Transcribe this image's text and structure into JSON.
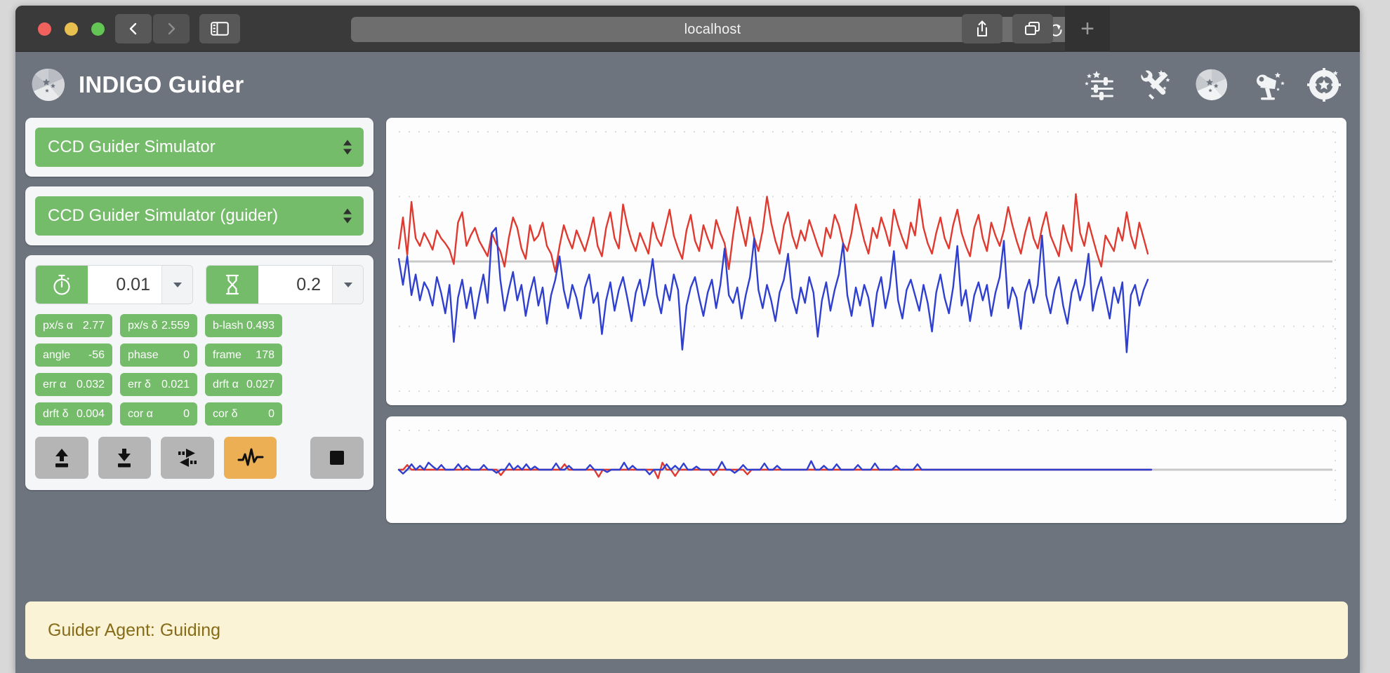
{
  "browser": {
    "url_text": "localhost",
    "back_icon": "chevron-left-icon",
    "forward_icon": "chevron-right-icon",
    "sidebar_icon": "sidebar-toggle-icon",
    "reload_icon": "reload-icon",
    "share_icon": "share-icon",
    "tabs_icon": "tab-overview-icon",
    "newtab_label": "+"
  },
  "app": {
    "title": "INDIGO Guider",
    "logo_icon": "aperture-star-logo-icon",
    "toolbar_icons": [
      {
        "name": "sliders-star-icon",
        "label": "Guider settings"
      },
      {
        "name": "tools-star-icon",
        "label": "Tools"
      },
      {
        "name": "aperture-star-icon",
        "label": "Imager"
      },
      {
        "name": "telescope-star-icon",
        "label": "Mount"
      },
      {
        "name": "guider-target-star-icon",
        "label": "Guider"
      }
    ]
  },
  "selectors": [
    {
      "name": "device-select",
      "value": "CCD Guider Simulator"
    },
    {
      "name": "guider-select",
      "value": "CCD Guider Simulator (guider)"
    }
  ],
  "steppers": [
    {
      "name": "exposure-stepper",
      "icon": "stopwatch-icon",
      "value": "0.01"
    },
    {
      "name": "delay-stepper",
      "icon": "hourglass-icon",
      "value": "0.2"
    }
  ],
  "badges": [
    {
      "label": "px/s α",
      "value": "2.77"
    },
    {
      "label": "px/s δ",
      "value": "2.559"
    },
    {
      "label": "b-lash",
      "value": "0.493"
    },
    {
      "label": "angle",
      "value": "-56"
    },
    {
      "label": "phase",
      "value": "0"
    },
    {
      "label": "frame",
      "value": "178"
    },
    {
      "label": "err α",
      "value": "0.032"
    },
    {
      "label": "err δ",
      "value": "0.021"
    },
    {
      "label": "drft α",
      "value": "0.027"
    },
    {
      "label": "drft δ",
      "value": "0.004"
    },
    {
      "label": "cor α",
      "value": "0"
    },
    {
      "label": "cor δ",
      "value": "0"
    }
  ],
  "buttons": [
    {
      "name": "upload-button",
      "icon": "upload-icon",
      "active": false
    },
    {
      "name": "download-button",
      "icon": "download-icon",
      "active": false
    },
    {
      "name": "calibrate-button",
      "icon": "calibrate-arrows-icon",
      "active": false
    },
    {
      "name": "guide-button",
      "icon": "pulse-icon",
      "active": true
    },
    {
      "name": "stop-button",
      "icon": "stop-square-icon",
      "active": false
    }
  ],
  "status": {
    "text": "Guider Agent: Guiding"
  },
  "colors": {
    "accent_green": "#74bb6a",
    "active_orange": "#edaf54",
    "app_background": "#6d747e",
    "status_background": "#fbf3d5",
    "status_text": "#866c18",
    "trace_alpha": "#e03a30",
    "trace_delta": "#2f3fd0",
    "zero_line": "#c9c9c9"
  },
  "chart_data": [
    {
      "type": "line",
      "name": "guiding-error-chart",
      "title": "",
      "xlabel": "",
      "ylabel": "",
      "grid": true,
      "gridlines_y": [
        0.0,
        0.25,
        0.75,
        1.0
      ],
      "zero_line_y": 0.5,
      "ylim": [
        -1,
        1
      ],
      "series": [
        {
          "name": "err α",
          "color": "#e03a30",
          "values": [
            0.1,
            0.34,
            0.05,
            0.46,
            0.18,
            0.12,
            0.22,
            0.16,
            0.09,
            0.24,
            0.18,
            0.14,
            0.09,
            -0.02,
            0.3,
            0.38,
            0.12,
            0.2,
            0.26,
            0.16,
            0.1,
            0.04,
            0.22,
            0.14,
            0.08,
            -0.04,
            0.18,
            0.34,
            0.26,
            0.1,
            0.02,
            0.28,
            0.16,
            0.2,
            0.3,
            0.12,
            0.06,
            -0.08,
            0.12,
            0.28,
            0.18,
            0.1,
            0.24,
            0.16,
            0.08,
            0.2,
            0.34,
            0.12,
            0.04,
            0.26,
            0.38,
            0.18,
            0.1,
            0.44,
            0.28,
            0.16,
            0.08,
            0.22,
            0.14,
            0.06,
            0.3,
            0.18,
            0.12,
            0.26,
            0.4,
            0.2,
            0.1,
            0.02,
            0.24,
            0.36,
            0.16,
            0.08,
            0.28,
            0.18,
            0.1,
            0.32,
            0.22,
            0.14,
            -0.06,
            0.2,
            0.42,
            0.26,
            0.12,
            0.34,
            0.18,
            0.08,
            0.24,
            0.5,
            0.3,
            0.16,
            0.06,
            0.28,
            0.38,
            0.2,
            0.1,
            0.24,
            0.16,
            0.32,
            0.22,
            0.12,
            0.04,
            0.26,
            0.18,
            0.36,
            0.28,
            0.14,
            0.08,
            0.22,
            0.44,
            0.3,
            0.16,
            0.06,
            0.26,
            0.18,
            0.34,
            0.24,
            0.12,
            0.4,
            0.28,
            0.18,
            0.1,
            0.3,
            0.2,
            0.48,
            0.26,
            0.14,
            0.06,
            0.22,
            0.34,
            0.18,
            0.1,
            0.28,
            0.4,
            0.22,
            0.12,
            0.04,
            0.26,
            0.36,
            0.18,
            0.08,
            0.3,
            0.2,
            0.12,
            0.24,
            0.42,
            0.28,
            0.16,
            0.06,
            0.22,
            0.34,
            0.18,
            0.1,
            0.26,
            0.38,
            0.2,
            0.12,
            0.04,
            0.28,
            0.16,
            0.08,
            0.52,
            0.22,
            0.12,
            0.3,
            0.18,
            0.06,
            -0.04,
            0.2,
            0.14,
            0.08,
            0.26,
            0.16,
            0.38,
            0.2,
            0.1,
            0.3,
            0.18,
            0.06
          ]
        },
        {
          "name": "err δ",
          "color": "#2f3fd0",
          "values": [
            0.02,
            -0.18,
            0.04,
            -0.26,
            -0.1,
            -0.3,
            -0.16,
            -0.22,
            -0.34,
            -0.12,
            -0.24,
            -0.4,
            -0.18,
            -0.62,
            -0.28,
            -0.14,
            -0.36,
            -0.2,
            -0.44,
            -0.26,
            -0.1,
            -0.32,
            0.22,
            0.26,
            -0.14,
            -0.38,
            -0.22,
            -0.08,
            -0.3,
            -0.18,
            -0.42,
            -0.24,
            -0.12,
            -0.34,
            -0.2,
            -0.48,
            -0.26,
            -0.14,
            0.04,
            -0.22,
            -0.36,
            -0.18,
            -0.28,
            -0.44,
            -0.2,
            -0.1,
            -0.32,
            -0.24,
            -0.56,
            -0.3,
            -0.16,
            -0.38,
            -0.22,
            -0.12,
            -0.28,
            -0.46,
            -0.24,
            -0.14,
            -0.34,
            -0.2,
            0.02,
            -0.26,
            -0.4,
            -0.18,
            -0.3,
            -0.1,
            -0.22,
            -0.68,
            -0.34,
            -0.2,
            -0.12,
            -0.28,
            -0.42,
            -0.24,
            -0.14,
            -0.36,
            -0.18,
            0.1,
            -0.26,
            -0.32,
            -0.2,
            -0.44,
            -0.26,
            -0.12,
            0.18,
            -0.22,
            -0.36,
            -0.18,
            -0.3,
            -0.46,
            -0.24,
            -0.14,
            0.06,
            -0.28,
            -0.4,
            -0.2,
            -0.32,
            -0.12,
            -0.24,
            -0.58,
            -0.3,
            -0.16,
            -0.38,
            -0.22,
            -0.1,
            0.14,
            -0.26,
            -0.42,
            -0.2,
            -0.34,
            -0.18,
            -0.28,
            -0.5,
            -0.24,
            -0.12,
            -0.36,
            -0.2,
            0.08,
            -0.3,
            -0.44,
            -0.22,
            -0.14,
            -0.26,
            -0.38,
            -0.18,
            -0.32,
            -0.54,
            -0.24,
            -0.1,
            -0.28,
            -0.4,
            -0.2,
            0.12,
            -0.34,
            -0.22,
            -0.46,
            -0.26,
            -0.16,
            -0.3,
            -0.18,
            -0.42,
            -0.24,
            -0.12,
            0.16,
            -0.36,
            -0.2,
            -0.28,
            -0.52,
            -0.24,
            -0.14,
            -0.32,
            -0.18,
            0.2,
            -0.26,
            -0.4,
            -0.22,
            -0.12,
            -0.34,
            -0.48,
            -0.24,
            -0.14,
            -0.3,
            -0.18,
            0.06,
            -0.38,
            -0.22,
            -0.12,
            -0.28,
            -0.44,
            -0.2,
            -0.32,
            -0.16,
            -0.7,
            -0.26,
            -0.18,
            -0.34,
            -0.22,
            -0.14
          ]
        }
      ]
    },
    {
      "type": "line",
      "name": "correction-chart",
      "title": "",
      "xlabel": "",
      "ylabel": "",
      "grid": true,
      "gridlines_y": [
        0.0
      ],
      "zero_line_y": 0.5,
      "ylim": [
        -1,
        1
      ],
      "series": [
        {
          "name": "cor α",
          "color": "#e03a30",
          "values": [
            0.0,
            0.0,
            0.12,
            0.0,
            0.0,
            0.0,
            0.0,
            0.0,
            0.0,
            0.0,
            0.0,
            0.0,
            0.0,
            0.0,
            0.0,
            0.0,
            0.0,
            0.0,
            0.0,
            0.0,
            0.0,
            0.0,
            0.0,
            0.0,
            -0.14,
            0.0,
            0.0,
            0.0,
            0.0,
            0.0,
            0.0,
            0.0,
            0.0,
            0.0,
            0.0,
            0.0,
            0.0,
            0.0,
            0.0,
            0.14,
            0.0,
            0.0,
            0.0,
            0.0,
            0.0,
            0.0,
            0.0,
            -0.18,
            0.0,
            0.0,
            0.0,
            0.0,
            0.0,
            0.0,
            0.0,
            0.0,
            0.0,
            0.0,
            0.0,
            0.0,
            0.0,
            -0.22,
            0.18,
            0.0,
            0.0,
            -0.16,
            0.0,
            0.0,
            0.0,
            0.0,
            0.0,
            0.0,
            0.0,
            0.0,
            -0.14,
            0.0,
            0.0,
            0.0,
            0.0,
            0.0,
            0.0,
            0.0,
            -0.12,
            0.0,
            0.0,
            0.0,
            0.0,
            0.0,
            0.0,
            0.0,
            0.0,
            0.0,
            0.0,
            0.0,
            0.0,
            0.0,
            0.0,
            0.0,
            0.0,
            0.0,
            0.0,
            0.0,
            0.0,
            0.0,
            0.0,
            0.0,
            0.0,
            0.0,
            0.0,
            0.0,
            0.0,
            0.0,
            0.0,
            0.0,
            0.0,
            0.0,
            0.0,
            0.0,
            0.0,
            0.0,
            0.0,
            0.0,
            0.0,
            0.0,
            0.0,
            0.0,
            0.0,
            0.0,
            0.0,
            0.0,
            0.0,
            0.0,
            0.0,
            0.0,
            0.0,
            0.0,
            0.0,
            0.0,
            0.0,
            0.0,
            0.0,
            0.0,
            0.0,
            0.0,
            0.0,
            0.0,
            0.0,
            0.0,
            0.0,
            0.0,
            0.0,
            0.0,
            0.0,
            0.0,
            0.0,
            0.0,
            0.0,
            0.0,
            0.0,
            0.0,
            0.0,
            0.0,
            0.0,
            0.0,
            0.0,
            0.0,
            0.0,
            0.0,
            0.0,
            0.0,
            0.0,
            0.0,
            0.0,
            0.0,
            0.0,
            0.0,
            0.0,
            0.0
          ]
        },
        {
          "name": "cor δ",
          "color": "#2f3fd0",
          "values": [
            0.0,
            -0.1,
            0.0,
            0.14,
            0.0,
            0.1,
            0.0,
            0.18,
            0.08,
            0.0,
            0.12,
            0.0,
            0.0,
            0.0,
            0.14,
            0.0,
            0.1,
            0.0,
            0.0,
            0.0,
            0.12,
            0.0,
            0.0,
            -0.08,
            0.0,
            0.0,
            0.16,
            0.0,
            0.1,
            0.0,
            0.14,
            0.0,
            0.08,
            0.0,
            0.0,
            0.0,
            0.0,
            0.16,
            0.0,
            0.0,
            0.1,
            0.0,
            0.0,
            0.0,
            0.0,
            0.12,
            0.0,
            0.0,
            0.0,
            -0.06,
            0.0,
            0.0,
            0.0,
            0.18,
            0.0,
            0.1,
            0.0,
            0.0,
            0.0,
            -0.12,
            0.0,
            0.0,
            0.0,
            0.14,
            0.0,
            0.1,
            0.0,
            0.16,
            0.0,
            0.0,
            0.08,
            0.0,
            0.0,
            0.0,
            0.0,
            0.0,
            0.2,
            0.0,
            0.0,
            -0.08,
            0.0,
            0.12,
            0.0,
            0.0,
            0.0,
            0.0,
            0.16,
            0.0,
            0.0,
            0.1,
            0.0,
            0.0,
            0.0,
            0.0,
            0.0,
            0.0,
            0.0,
            0.22,
            0.0,
            0.0,
            0.1,
            0.0,
            0.0,
            0.14,
            0.0,
            0.0,
            0.0,
            0.0,
            0.12,
            0.0,
            0.0,
            0.0,
            0.16,
            0.0,
            0.0,
            0.0,
            0.0,
            0.1,
            0.0,
            0.0,
            0.0,
            0.0,
            0.14,
            0.0,
            0.0,
            0.0,
            0.0,
            0.0,
            0.0,
            0.0,
            0.0,
            0.0,
            0.0,
            0.0,
            0.0,
            0.0,
            0.0,
            0.0,
            0.0,
            0.0,
            0.0,
            0.0,
            0.0,
            0.0,
            0.0,
            0.0,
            0.0,
            0.0,
            0.0,
            0.0,
            0.0,
            0.0,
            0.0,
            0.0,
            0.0,
            0.0,
            0.0,
            0.0,
            0.0,
            0.0,
            0.0,
            0.0,
            0.0,
            0.0,
            0.0,
            0.0,
            0.0,
            0.0,
            0.0,
            0.0,
            0.0,
            0.0,
            0.0,
            0.0,
            0.0,
            0.0,
            0.0,
            0.0
          ]
        }
      ]
    }
  ]
}
